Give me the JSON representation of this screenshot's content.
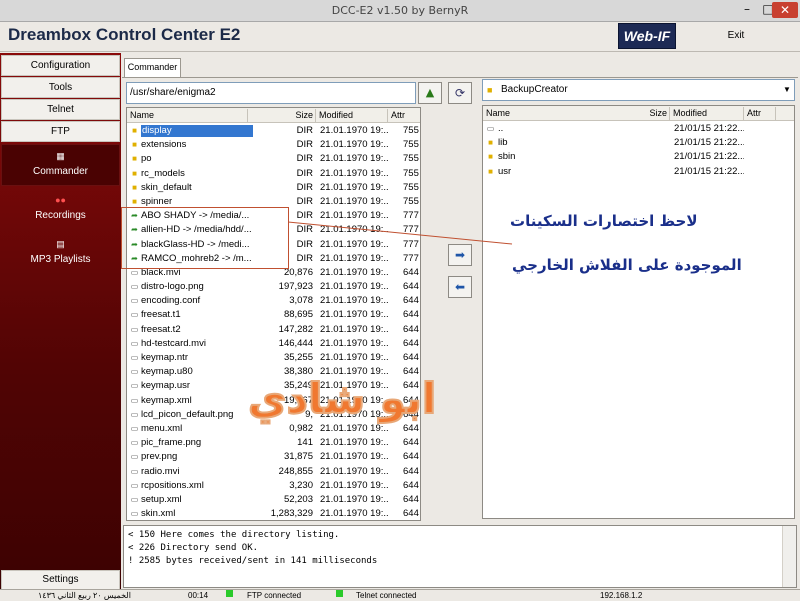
{
  "window": {
    "title": "DCC-E2 v1.50 by BernyR",
    "min": "–",
    "max": "□",
    "close": "✕"
  },
  "app": {
    "title": "Dreambox Control Center E2",
    "webif_label": "Web-IF",
    "exit_label": "Exit"
  },
  "sidebar": {
    "configuration": "Configuration",
    "tools": "Tools",
    "telnet": "Telnet",
    "ftp": "FTP",
    "commander": "Commander",
    "recordings": "Recordings",
    "mp3": "MP3 Playlists",
    "settings": "Settings"
  },
  "tab": {
    "label": "Commander"
  },
  "left": {
    "path": "/usr/share/enigma2",
    "headers": {
      "name": "Name",
      "size": "Size",
      "modified": "Modified",
      "attr": "Attr"
    },
    "rows": [
      {
        "icon": "folder",
        "name": "display",
        "size": "DIR",
        "modified": "21.01.1970 19:...",
        "attr": "755"
      },
      {
        "icon": "folder",
        "name": "extensions",
        "size": "DIR",
        "modified": "21.01.1970 19:...",
        "attr": "755"
      },
      {
        "icon": "folder",
        "name": "po",
        "size": "DIR",
        "modified": "21.01.1970 19:...",
        "attr": "755"
      },
      {
        "icon": "folder",
        "name": "rc_models",
        "size": "DIR",
        "modified": "21.01.1970 19:...",
        "attr": "755"
      },
      {
        "icon": "folder",
        "name": "skin_default",
        "size": "DIR",
        "modified": "21.01.1970 19:...",
        "attr": "755"
      },
      {
        "icon": "folder",
        "name": "spinner",
        "size": "DIR",
        "modified": "21.01.1970 19:...",
        "attr": "755"
      },
      {
        "icon": "link",
        "name": "ABO SHADY -> /media/...",
        "size": "DIR",
        "modified": "21.01.1970 19:...",
        "attr": "777"
      },
      {
        "icon": "link",
        "name": "allien-HD -> /media/hdd/...",
        "size": "DIR",
        "modified": "21.01.1970 19:...",
        "attr": "777"
      },
      {
        "icon": "link",
        "name": "blackGlass-HD -> /medi...",
        "size": "DIR",
        "modified": "21.01.1970 19:...",
        "attr": "777"
      },
      {
        "icon": "link",
        "name": "RAMCO_mohreb2 -> /m...",
        "size": "DIR",
        "modified": "21.01.1970 19:...",
        "attr": "777"
      },
      {
        "icon": "file",
        "name": "black.mvi",
        "size": "20,876",
        "modified": "21.01.1970 19:...",
        "attr": "644"
      },
      {
        "icon": "file",
        "name": "distro-logo.png",
        "size": "197,923",
        "modified": "21.01.1970 19:...",
        "attr": "644"
      },
      {
        "icon": "file",
        "name": "encoding.conf",
        "size": "3,078",
        "modified": "21.01.1970 19:...",
        "attr": "644"
      },
      {
        "icon": "file",
        "name": "freesat.t1",
        "size": "88,695",
        "modified": "21.01.1970 19:...",
        "attr": "644"
      },
      {
        "icon": "file",
        "name": "freesat.t2",
        "size": "147,282",
        "modified": "21.01.1970 19:...",
        "attr": "644"
      },
      {
        "icon": "file",
        "name": "hd-testcard.mvi",
        "size": "146,444",
        "modified": "21.01.1970 19:...",
        "attr": "644"
      },
      {
        "icon": "file",
        "name": "keymap.ntr",
        "size": "35,255",
        "modified": "21.01.1970 19:...",
        "attr": "644"
      },
      {
        "icon": "file",
        "name": "keymap.u80",
        "size": "38,380",
        "modified": "21.01.1970 19:...",
        "attr": "644"
      },
      {
        "icon": "file",
        "name": "keymap.usr",
        "size": "35,249",
        "modified": "21.01.1970 19:...",
        "attr": "644"
      },
      {
        "icon": "file",
        "name": "keymap.xml",
        "size": "19,367",
        "modified": "21.01.1970 19:...",
        "attr": "644"
      },
      {
        "icon": "file",
        "name": "lcd_picon_default.png",
        "size": "9,",
        "modified": "21.01.1970 19:...",
        "attr": "644"
      },
      {
        "icon": "file",
        "name": "menu.xml",
        "size": "0,982",
        "modified": "21.01.1970 19:...",
        "attr": "644"
      },
      {
        "icon": "file",
        "name": "pic_frame.png",
        "size": "141",
        "modified": "21.01.1970 19:...",
        "attr": "644"
      },
      {
        "icon": "file",
        "name": "prev.png",
        "size": "31,875",
        "modified": "21.01.1970 19:...",
        "attr": "644"
      },
      {
        "icon": "file",
        "name": "radio.mvi",
        "size": "248,855",
        "modified": "21.01.1970 19:...",
        "attr": "644"
      },
      {
        "icon": "file",
        "name": "rcpositions.xml",
        "size": "3,230",
        "modified": "21.01.1970 19:...",
        "attr": "644"
      },
      {
        "icon": "file",
        "name": "setup.xml",
        "size": "52,203",
        "modified": "21.01.1970 19:...",
        "attr": "644"
      },
      {
        "icon": "file",
        "name": "skin.xml",
        "size": "1,283,329",
        "modified": "21.01.1970 19:...",
        "attr": "644"
      }
    ]
  },
  "right": {
    "path": "BackupCreator",
    "headers": {
      "name": "Name",
      "size": "Size",
      "modified": "Modified",
      "attr": "Attr"
    },
    "rows": [
      {
        "icon": "file",
        "name": "..",
        "size": "",
        "modified": "21/01/15 21:22...",
        "attr": ""
      },
      {
        "icon": "folder",
        "name": "lib",
        "size": "",
        "modified": "21/01/15 21:22...",
        "attr": ""
      },
      {
        "icon": "folder",
        "name": "sbin",
        "size": "",
        "modified": "21/01/15 21:22...",
        "attr": ""
      },
      {
        "icon": "folder",
        "name": "usr",
        "size": "",
        "modified": "21/01/15 21:22...",
        "attr": ""
      }
    ]
  },
  "log": {
    "lines": [
      "< 150 Here comes the directory listing.",
      "< 226 Directory send OK.",
      "! 2585 bytes received/sent in 141 milliseconds"
    ]
  },
  "status": {
    "date": "الخميس ٢٠ ربيع الثاني ١٤٣٦",
    "time": "00:14",
    "ftp": "FTP connected",
    "telnet": "Telnet connected",
    "ip": "192.168.1.2"
  },
  "annotation": {
    "line1": "لاحظ اختصارات السكينات",
    "line2": "الموجودة على الفلاش الخارجي",
    "watermark": "ابو شادي"
  },
  "colors": {
    "sidebar": "#8a0a0a",
    "selection": "#3377d0",
    "annotation": "#1a2f8a",
    "watermark": "#f07830"
  }
}
